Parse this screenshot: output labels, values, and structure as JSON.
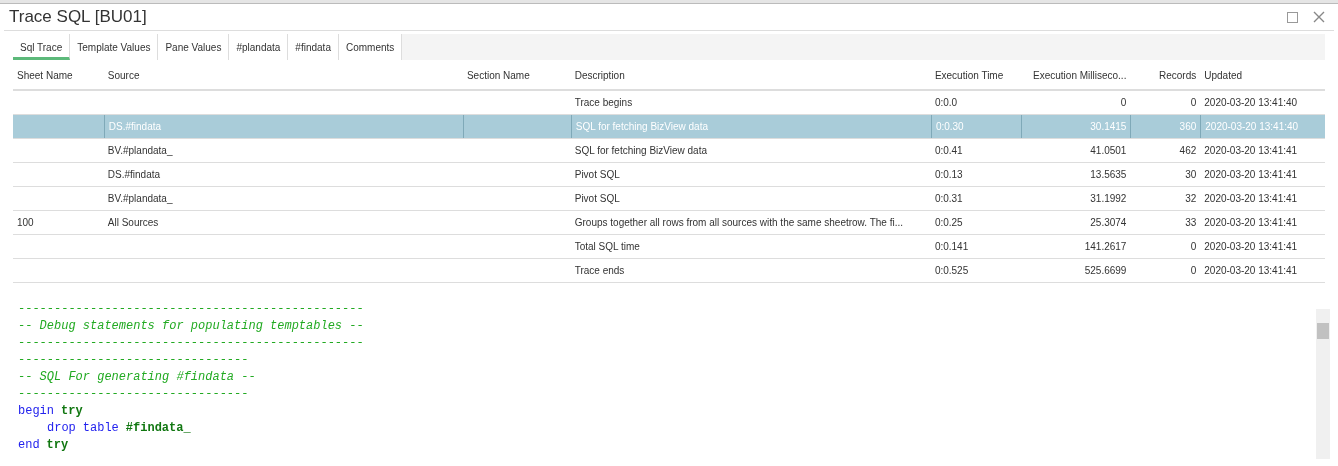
{
  "window": {
    "title": "Trace SQL [BU01]"
  },
  "tabs": [
    {
      "label": "Sql Trace",
      "selected": true
    },
    {
      "label": "Template Values",
      "selected": false
    },
    {
      "label": "Pane Values",
      "selected": false
    },
    {
      "label": "#plandata",
      "selected": false
    },
    {
      "label": "#findata",
      "selected": false
    },
    {
      "label": "Comments",
      "selected": false
    }
  ],
  "table": {
    "columns": [
      "Sheet Name",
      "Source",
      "Section Name",
      "Description",
      "Execution Time",
      "Execution Milliseco...",
      "Records",
      "Updated"
    ],
    "rows": [
      {
        "selected": false,
        "cells": [
          "",
          "",
          "",
          "Trace begins",
          "0:0.0",
          "0",
          "0",
          "2020-03-20 13:41:40"
        ]
      },
      {
        "selected": true,
        "cells": [
          "",
          "DS.#findata",
          "",
          "SQL for fetching BizView data",
          "0:0.30",
          "30.1415",
          "360",
          "2020-03-20 13:41:40"
        ]
      },
      {
        "selected": false,
        "cells": [
          "",
          "BV.#plandata_",
          "",
          "SQL for fetching BizView data",
          "0:0.41",
          "41.0501",
          "462",
          "2020-03-20 13:41:41"
        ]
      },
      {
        "selected": false,
        "cells": [
          "",
          "DS.#findata",
          "",
          "Pivot SQL",
          "0:0.13",
          "13.5635",
          "30",
          "2020-03-20 13:41:41"
        ]
      },
      {
        "selected": false,
        "cells": [
          "",
          "BV.#plandata_",
          "",
          "Pivot SQL",
          "0:0.31",
          "31.1992",
          "32",
          "2020-03-20 13:41:41"
        ]
      },
      {
        "selected": false,
        "cells": [
          "100",
          "All Sources",
          "",
          "Groups together all rows from all sources with the same sheetrow. The fi...",
          "0:0.25",
          "25.3074",
          "33",
          "2020-03-20 13:41:41"
        ]
      },
      {
        "selected": false,
        "cells": [
          "",
          "",
          "",
          "Total SQL time",
          "0:0.141",
          "141.2617",
          "0",
          "2020-03-20 13:41:41"
        ]
      },
      {
        "selected": false,
        "cells": [
          "",
          "",
          "",
          "Trace ends",
          "0:0.525",
          "525.6699",
          "0",
          "2020-03-20 13:41:41"
        ]
      }
    ]
  },
  "code": [
    {
      "indented": false,
      "tokens": [
        {
          "kind": "comment",
          "text": "------------------------------------------------"
        }
      ]
    },
    {
      "indented": false,
      "tokens": [
        {
          "kind": "comment",
          "text": "-- Debug statements for populating temptables --"
        }
      ]
    },
    {
      "indented": false,
      "tokens": [
        {
          "kind": "comment",
          "text": "------------------------------------------------"
        }
      ]
    },
    {
      "indented": false,
      "tokens": [
        {
          "kind": "comment",
          "text": "--------------------------------"
        }
      ]
    },
    {
      "indented": false,
      "tokens": [
        {
          "kind": "comment",
          "text": "-- SQL For generating #findata --"
        }
      ]
    },
    {
      "indented": false,
      "tokens": [
        {
          "kind": "comment",
          "text": "--------------------------------"
        }
      ]
    },
    {
      "indented": false,
      "tokens": [
        {
          "kind": "keyword",
          "text": "begin"
        },
        {
          "kind": "bold",
          "text": "try"
        }
      ]
    },
    {
      "indented": true,
      "tokens": [
        {
          "kind": "keyword",
          "text": "drop"
        },
        {
          "kind": "keyword",
          "text": "table"
        },
        {
          "kind": "bold",
          "text": "#findata_"
        }
      ]
    },
    {
      "indented": false,
      "tokens": [
        {
          "kind": "keyword",
          "text": "end"
        },
        {
          "kind": "bold",
          "text": "try"
        }
      ]
    }
  ]
}
